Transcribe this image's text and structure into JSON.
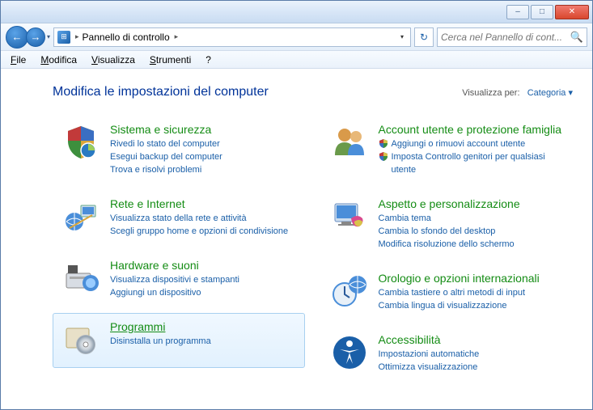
{
  "titlebar": {
    "minimize": "–",
    "maximize": "□",
    "close": "✕"
  },
  "nav": {
    "back": "←",
    "forward": "→",
    "addr_icon": "⊞",
    "breadcrumb": "Pannello di controllo",
    "arrow": "▸",
    "dropdown": "▾",
    "refresh": "↻",
    "search_placeholder": "Cerca nel Pannello di cont...",
    "search_icon": "🔍"
  },
  "menu": {
    "file": "File",
    "file_u": "F",
    "edit": "Modifica",
    "edit_u": "M",
    "view": "Visualizza",
    "view_u": "V",
    "tools": "Strumenti",
    "tools_u": "S",
    "help": "?"
  },
  "header": {
    "title": "Modifica le impostazioni del computer",
    "viewby_label": "Visualizza per:",
    "viewby_value": "Categoria"
  },
  "left": [
    {
      "title": "Sistema e sicurezza",
      "links": [
        "Rivedi lo stato del computer",
        "Esegui backup del computer",
        "Trova e risolvi problemi"
      ],
      "shields": []
    },
    {
      "title": "Rete e Internet",
      "links": [
        "Visualizza stato della rete e attività",
        "Scegli gruppo home e opzioni di condivisione"
      ],
      "shields": []
    },
    {
      "title": "Hardware e suoni",
      "links": [
        "Visualizza dispositivi e stampanti",
        "Aggiungi un dispositivo"
      ],
      "shields": []
    },
    {
      "title": "Programmi",
      "links": [
        "Disinstalla un programma"
      ],
      "shields": [],
      "selected": true
    }
  ],
  "right": [
    {
      "title": "Account utente e protezione famiglia",
      "links": [
        "Aggiungi o rimuovi account utente",
        "Imposta Controllo genitori per qualsiasi utente"
      ],
      "shields": [
        0,
        1
      ]
    },
    {
      "title": "Aspetto e personalizzazione",
      "links": [
        "Cambia tema",
        "Cambia lo sfondo del desktop",
        "Modifica risoluzione dello schermo"
      ],
      "shields": []
    },
    {
      "title": "Orologio e opzioni internazionali",
      "links": [
        "Cambia tastiere o altri metodi di input",
        "Cambia lingua di visualizzazione"
      ],
      "shields": []
    },
    {
      "title": "Accessibilità",
      "links": [
        "Impostazioni automatiche",
        "Ottimizza visualizzazione"
      ],
      "shields": []
    }
  ]
}
